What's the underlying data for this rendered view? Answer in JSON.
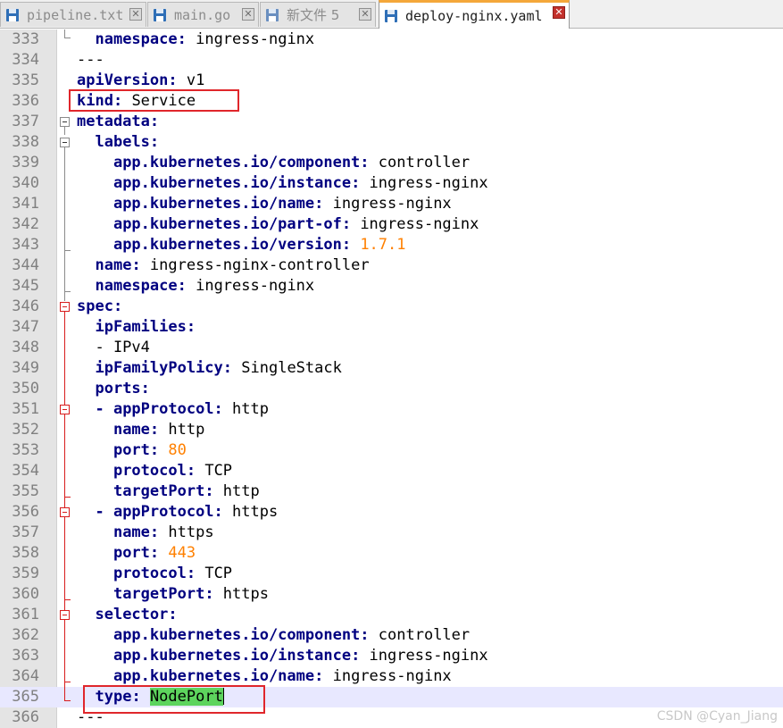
{
  "tabs": [
    {
      "label": "pipeline.txt",
      "active": false
    },
    {
      "label": "main.go",
      "active": false
    },
    {
      "label": "新文件 5",
      "active": false
    },
    {
      "label": "deploy-nginx.yaml",
      "active": true
    }
  ],
  "colors": {
    "key": "#000080",
    "number": "#ff8000",
    "selection": "#5dd45d",
    "annotation": "#e0262b",
    "current_line": "#e8e8ff"
  },
  "editor": {
    "lines": [
      {
        "num": "333",
        "indent": "  ",
        "key": "namespace",
        "val": " ingress-nginx"
      },
      {
        "num": "334",
        "text": "---"
      },
      {
        "num": "335",
        "indent": "",
        "key": "apiVersion",
        "val": " v1"
      },
      {
        "num": "336",
        "indent": "",
        "key": "kind",
        "val": " Service"
      },
      {
        "num": "337",
        "indent": "",
        "key": "metadata",
        "val": ""
      },
      {
        "num": "338",
        "indent": "  ",
        "key": "labels",
        "val": ""
      },
      {
        "num": "339",
        "indent": "    ",
        "key": "app.kubernetes.io/component",
        "val": " controller"
      },
      {
        "num": "340",
        "indent": "    ",
        "key": "app.kubernetes.io/instance",
        "val": " ingress-nginx"
      },
      {
        "num": "341",
        "indent": "    ",
        "key": "app.kubernetes.io/name",
        "val": " ingress-nginx"
      },
      {
        "num": "342",
        "indent": "    ",
        "key": "app.kubernetes.io/part-of",
        "val": " ingress-nginx"
      },
      {
        "num": "343",
        "indent": "    ",
        "key": "app.kubernetes.io/version",
        "num_val": " 1.7.1"
      },
      {
        "num": "344",
        "indent": "  ",
        "key": "name",
        "val": " ingress-nginx-controller"
      },
      {
        "num": "345",
        "indent": "  ",
        "key": "namespace",
        "val": " ingress-nginx"
      },
      {
        "num": "346",
        "indent": "",
        "key": "spec",
        "val": ""
      },
      {
        "num": "347",
        "indent": "  ",
        "key": "ipFamilies",
        "val": ""
      },
      {
        "num": "348",
        "text": "  - IPv4"
      },
      {
        "num": "349",
        "indent": "  ",
        "key": "ipFamilyPolicy",
        "val": " SingleStack"
      },
      {
        "num": "350",
        "indent": "  ",
        "key": "ports",
        "val": ""
      },
      {
        "num": "351",
        "indent": "  ",
        "key": "- appProtocol",
        "val": " http"
      },
      {
        "num": "352",
        "indent": "    ",
        "key": "name",
        "val": " http"
      },
      {
        "num": "353",
        "indent": "    ",
        "key": "port",
        "num_val": " 80"
      },
      {
        "num": "354",
        "indent": "    ",
        "key": "protocol",
        "val": " TCP"
      },
      {
        "num": "355",
        "indent": "    ",
        "key": "targetPort",
        "val": " http"
      },
      {
        "num": "356",
        "indent": "  ",
        "key": "- appProtocol",
        "val": " https"
      },
      {
        "num": "357",
        "indent": "    ",
        "key": "name",
        "val": " https"
      },
      {
        "num": "358",
        "indent": "    ",
        "key": "port",
        "num_val": " 443"
      },
      {
        "num": "359",
        "indent": "    ",
        "key": "protocol",
        "val": " TCP"
      },
      {
        "num": "360",
        "indent": "    ",
        "key": "targetPort",
        "val": " https"
      },
      {
        "num": "361",
        "indent": "  ",
        "key": "selector",
        "val": ""
      },
      {
        "num": "362",
        "indent": "    ",
        "key": "app.kubernetes.io/component",
        "val": " controller"
      },
      {
        "num": "363",
        "indent": "    ",
        "key": "app.kubernetes.io/instance",
        "val": " ingress-nginx"
      },
      {
        "num": "364",
        "indent": "    ",
        "key": "app.kubernetes.io/name",
        "val": " ingress-nginx"
      },
      {
        "num": "365",
        "indent": "  ",
        "key": "type",
        "sel_val": "NodePort",
        "current": true
      },
      {
        "num": "366",
        "text": "---"
      }
    ]
  },
  "watermark": "CSDN @Cyan_Jiang"
}
